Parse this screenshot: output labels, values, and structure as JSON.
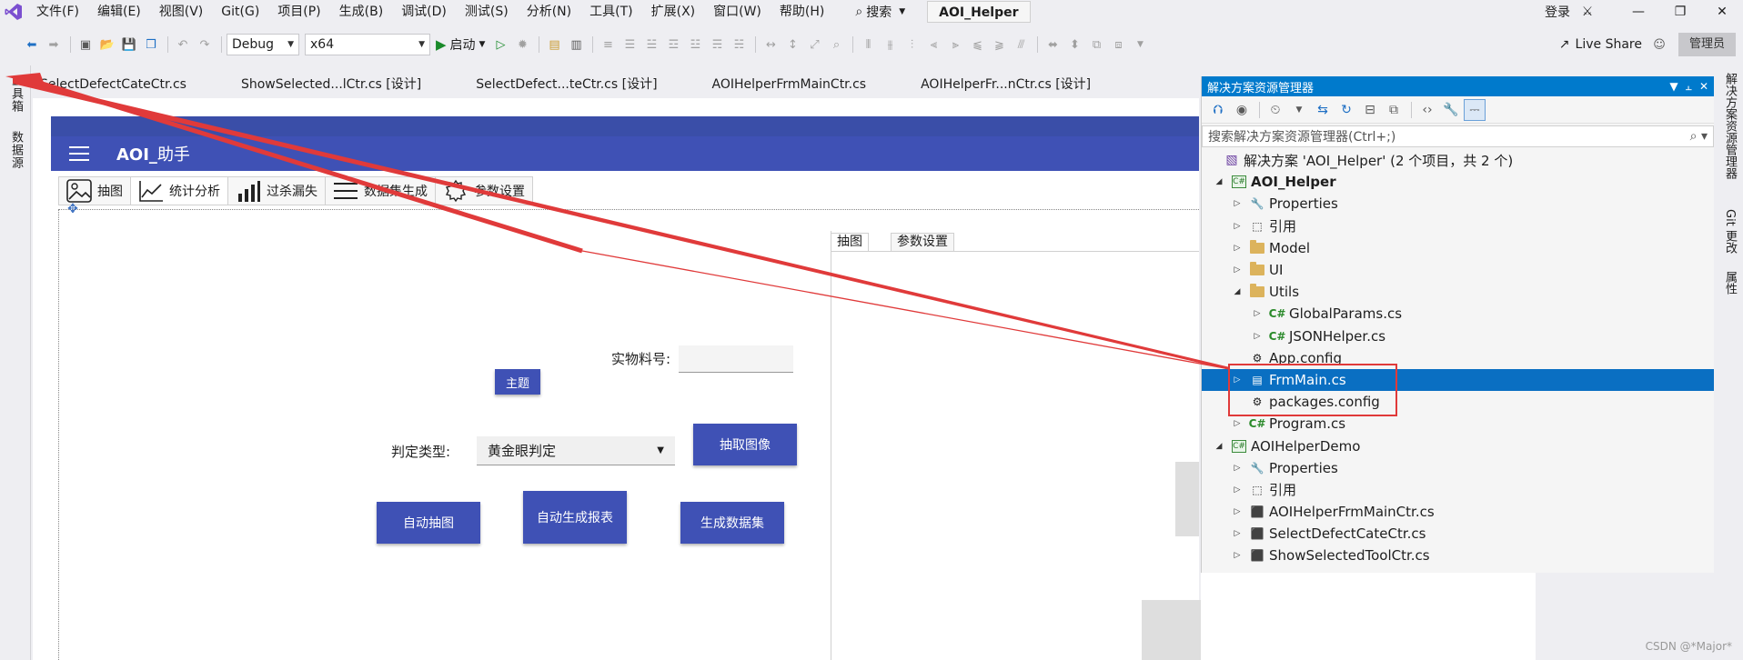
{
  "menu": {
    "items": [
      "文件(F)",
      "编辑(E)",
      "视图(V)",
      "Git(G)",
      "项目(P)",
      "生成(B)",
      "调试(D)",
      "测试(S)",
      "分析(N)",
      "工具(T)",
      "扩展(X)",
      "窗口(W)",
      "帮助(H)"
    ],
    "search_label": "搜索",
    "solution_name": "AOI_Helper",
    "login": "登录"
  },
  "toolbar": {
    "config": "Debug",
    "platform": "x64",
    "start": "启动",
    "live_share": "Live Share",
    "admin": "管理员"
  },
  "left_strip": {
    "toolbox": "工具箱",
    "datasource": "数据源"
  },
  "doc_tabs": [
    "SelectDefectCateCtr.cs",
    "ShowSelected...lCtr.cs [设计]",
    "SelectDefect...teCtr.cs [设计]",
    "AOIHelperFrmMainCtr.cs",
    "AOIHelperFr...nCtr.cs [设计]"
  ],
  "form": {
    "title_prefix": "AOI_",
    "title_suffix": "助手",
    "nav_tabs": [
      "抽图",
      "统计分析",
      "过杀漏失",
      "数据集生成",
      "参数设置"
    ],
    "material_label": "实物料号:",
    "theme_button": "主题",
    "judge_label": "判定类型:",
    "judge_value": "黄金眼判定",
    "extract_button": "抽取图像",
    "auto_extract_button": "自动抽图",
    "auto_report_button": "自动生成报表",
    "dataset_button": "生成数据集",
    "inner_tabs": [
      "抽图",
      "参数设置"
    ]
  },
  "solution_explorer": {
    "title": "解决方案资源管理器",
    "search_placeholder": "搜索解决方案资源管理器(Ctrl+;)",
    "rows": [
      {
        "label": "解决方案 'AOI_Helper' (2 个项目，共 2 个)"
      },
      {
        "label": "AOI_Helper"
      },
      {
        "label": "Properties"
      },
      {
        "label": "引用"
      },
      {
        "label": "Model"
      },
      {
        "label": "UI"
      },
      {
        "label": "Utils"
      },
      {
        "label": "GlobalParams.cs"
      },
      {
        "label": "JSONHelper.cs"
      },
      {
        "label": "App.config"
      },
      {
        "label": "FrmMain.cs"
      },
      {
        "label": "packages.config"
      },
      {
        "label": "Program.cs"
      },
      {
        "label": "AOIHelperDemo"
      },
      {
        "label": "Properties"
      },
      {
        "label": "引用"
      },
      {
        "label": "AOIHelperFrmMainCtr.cs"
      },
      {
        "label": "SelectDefectCateCtr.cs"
      },
      {
        "label": "ShowSelectedToolCtr.cs"
      }
    ]
  },
  "right_strip": {
    "se": "解决方案资源管理器",
    "git": "Git 更改",
    "props": "属性"
  },
  "watermark": "CSDN @*Major*",
  "colors": {
    "accent": "#007acc",
    "form_primary": "#3f51b5",
    "annotation": "#e03a3a",
    "selected_row": "#0a6fc2"
  }
}
